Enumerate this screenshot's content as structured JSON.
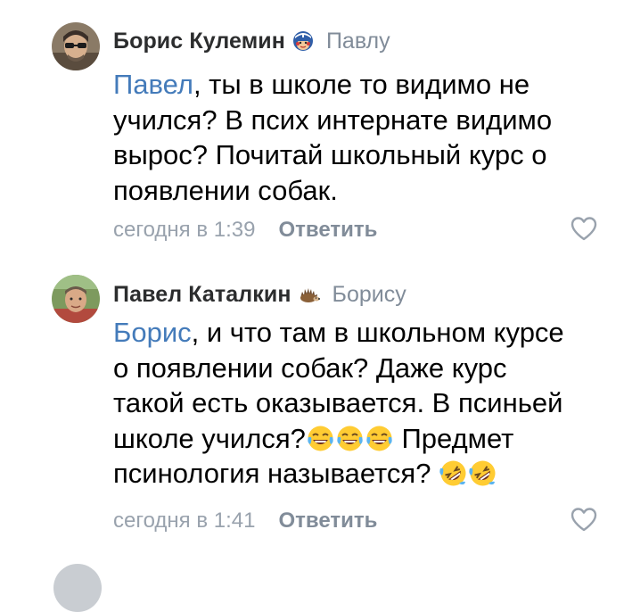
{
  "comments": [
    {
      "author": "Борис Кулемин",
      "badge_icon": "captain-america-emoji-icon",
      "reply_to": "Павлу",
      "body": {
        "mention": "Павел",
        "lines": [
          ", ты в школе то видимо не",
          "учился? В псих интернате видимо",
          "вырос? Почитай школьный курс о",
          "появлении собак."
        ]
      },
      "timestamp": "сегодня в 1:39",
      "reply_label": "Ответить",
      "like_icon": "heart-outline-icon"
    },
    {
      "author": "Павел Каталкин",
      "badge_icon": "hedgehog-icon",
      "reply_to": "Борису",
      "body": {
        "mention": "Борис",
        "lines": [
          ", и что там в школьном курсе",
          "о появлении собак? Даже курс",
          "такой есть оказывается.  В псиньей",
          "школе учился?",
          " Предмет",
          "псинология называется? "
        ],
        "emojis": {
          "line4": [
            "face-with-tears-of-joy",
            "face-with-tears-of-joy",
            "face-with-tears-of-joy"
          ],
          "line5": [
            "rolling-on-the-floor-laughing",
            "rolling-on-the-floor-laughing"
          ]
        }
      },
      "timestamp": "сегодня в 1:41",
      "reply_label": "Ответить",
      "like_icon": "heart-outline-icon"
    }
  ],
  "colors": {
    "author": "#2c2d2e",
    "mention": "#447bba",
    "secondary": "#818c99",
    "timestamp": "#99a2ad"
  }
}
